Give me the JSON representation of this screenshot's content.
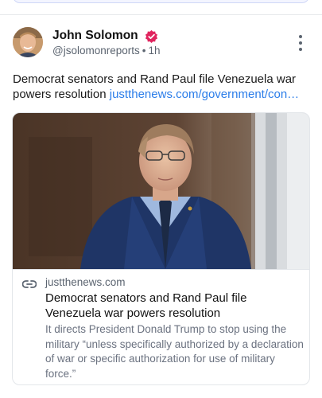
{
  "post": {
    "author_name": "John Solomon",
    "handle": "@jsolomonreports",
    "separator": "•",
    "time": "1h",
    "text_line1": "Democrat senators and Rand Paul file Venezuela war",
    "text_line2_prefix": "powers resolution ",
    "link_text": "justthenews.com/government/con…"
  },
  "card": {
    "domain": "justthenews.com",
    "title": "Democrat senators and Rand Paul file Venezuela war powers resolution",
    "description": "It directs President Donald Trump to stop using the military “unless specifically authorized by a declaration of war or specific authorization for use of military force.”"
  },
  "icons": {
    "verified": "verified-badge-icon",
    "more": "more-vertical-icon",
    "link": "link-icon"
  },
  "colors": {
    "link": "#2b7de9",
    "verified_badge": "#e0245e",
    "muted_text": "#5b6470"
  }
}
